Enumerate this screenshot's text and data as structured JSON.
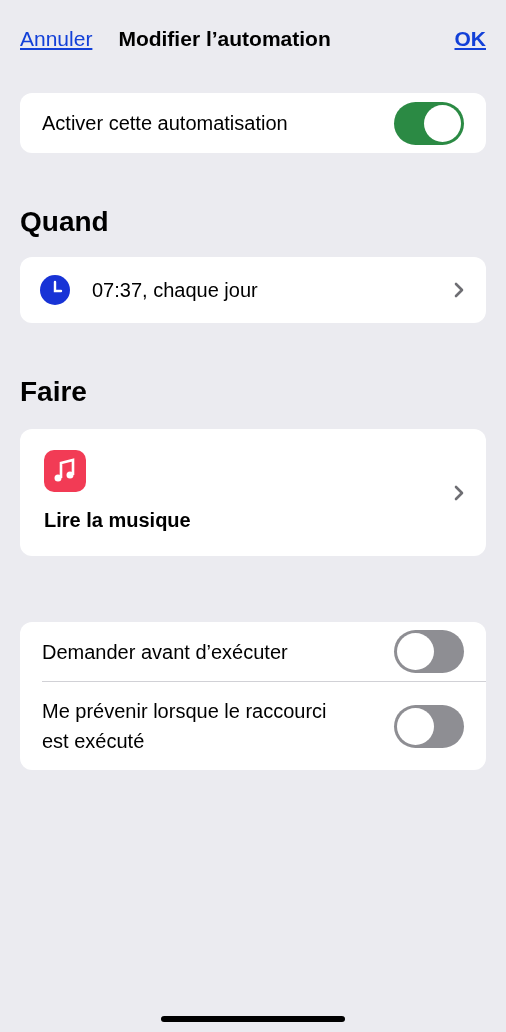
{
  "nav": {
    "cancel": "Annuler",
    "title": "Modifier l’automation",
    "done": "OK"
  },
  "enable": {
    "label": "Activer cette automatisation",
    "on": true
  },
  "when": {
    "heading": "Quand",
    "trigger": "07:37, chaque jour"
  },
  "do": {
    "heading": "Faire",
    "action": "Lire la musique"
  },
  "options": [
    {
      "label": "Demander avant d’exécuter",
      "on": false
    },
    {
      "label": "Me prévenir lorsque le raccourci est exécuté",
      "on": false
    }
  ]
}
